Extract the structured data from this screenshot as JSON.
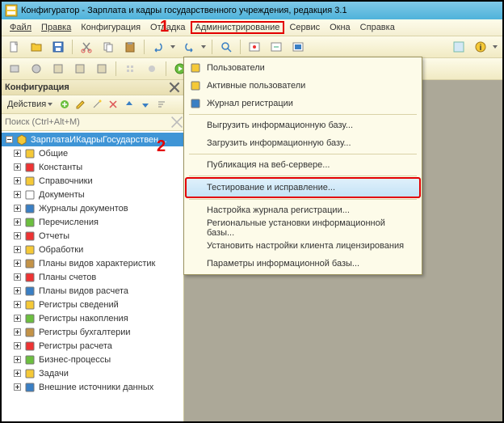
{
  "title": "Конфигуратор - Зарплата и кадры государственного учреждения, редакция 3.1",
  "menubar": {
    "file": "Файл",
    "edit": "Правка",
    "config": "Конфигурация",
    "debug": "Отладка",
    "admin": "Администрирование",
    "service": "Сервис",
    "windows": "Окна",
    "help": "Справка"
  },
  "panel": {
    "title": "Конфигурация",
    "actions": "Действия",
    "search_placeholder": "Поиск (Ctrl+Alt+M)",
    "root": "ЗарплатаИКадрыГосударственного...",
    "items": [
      {
        "label": "Общие",
        "icon": "gears"
      },
      {
        "label": "Константы",
        "icon": "asterisk"
      },
      {
        "label": "Справочники",
        "icon": "list-yellow"
      },
      {
        "label": "Документы",
        "icon": "doc"
      },
      {
        "label": "Журналы документов",
        "icon": "book"
      },
      {
        "label": "Перечисления",
        "icon": "enum"
      },
      {
        "label": "Отчеты",
        "icon": "report"
      },
      {
        "label": "Обработки",
        "icon": "process"
      },
      {
        "label": "Планы видов характеристик",
        "icon": "plan-char"
      },
      {
        "label": "Планы счетов",
        "icon": "t-accounts"
      },
      {
        "label": "Планы видов расчета",
        "icon": "plan-calc"
      },
      {
        "label": "Регистры сведений",
        "icon": "reg-info"
      },
      {
        "label": "Регистры накопления",
        "icon": "reg-acc"
      },
      {
        "label": "Регистры бухгалтерии",
        "icon": "reg-book"
      },
      {
        "label": "Регистры расчета",
        "icon": "reg-calc"
      },
      {
        "label": "Бизнес-процессы",
        "icon": "bp"
      },
      {
        "label": "Задачи",
        "icon": "task"
      },
      {
        "label": "Внешние источники данных",
        "icon": "ext-db"
      }
    ]
  },
  "dropdown": [
    {
      "label": "Пользователи",
      "icon": "user",
      "sep": false
    },
    {
      "label": "Активные пользователи",
      "icon": "users",
      "sep": false
    },
    {
      "label": "Журнал регистрации",
      "icon": "journal",
      "sep": true
    },
    {
      "label": "Выгрузить информационную базу...",
      "icon": "",
      "sep": false
    },
    {
      "label": "Загрузить информационную базу...",
      "icon": "",
      "sep": true
    },
    {
      "label": "Публикация на веб-сервере...",
      "icon": "",
      "sep": true
    },
    {
      "label": "Тестирование и исправление...",
      "icon": "",
      "sep": true,
      "hover": true,
      "highlight": true
    },
    {
      "label": "Настройка журнала регистрации...",
      "icon": "",
      "sep": false
    },
    {
      "label": "Региональные установки информационной базы...",
      "icon": "",
      "sep": false
    },
    {
      "label": "Установить настройки клиента лицензирования",
      "icon": "",
      "sep": false
    },
    {
      "label": "Параметры информационной базы...",
      "icon": "",
      "sep": false
    }
  ],
  "markers": {
    "one": "1",
    "two": "2"
  }
}
